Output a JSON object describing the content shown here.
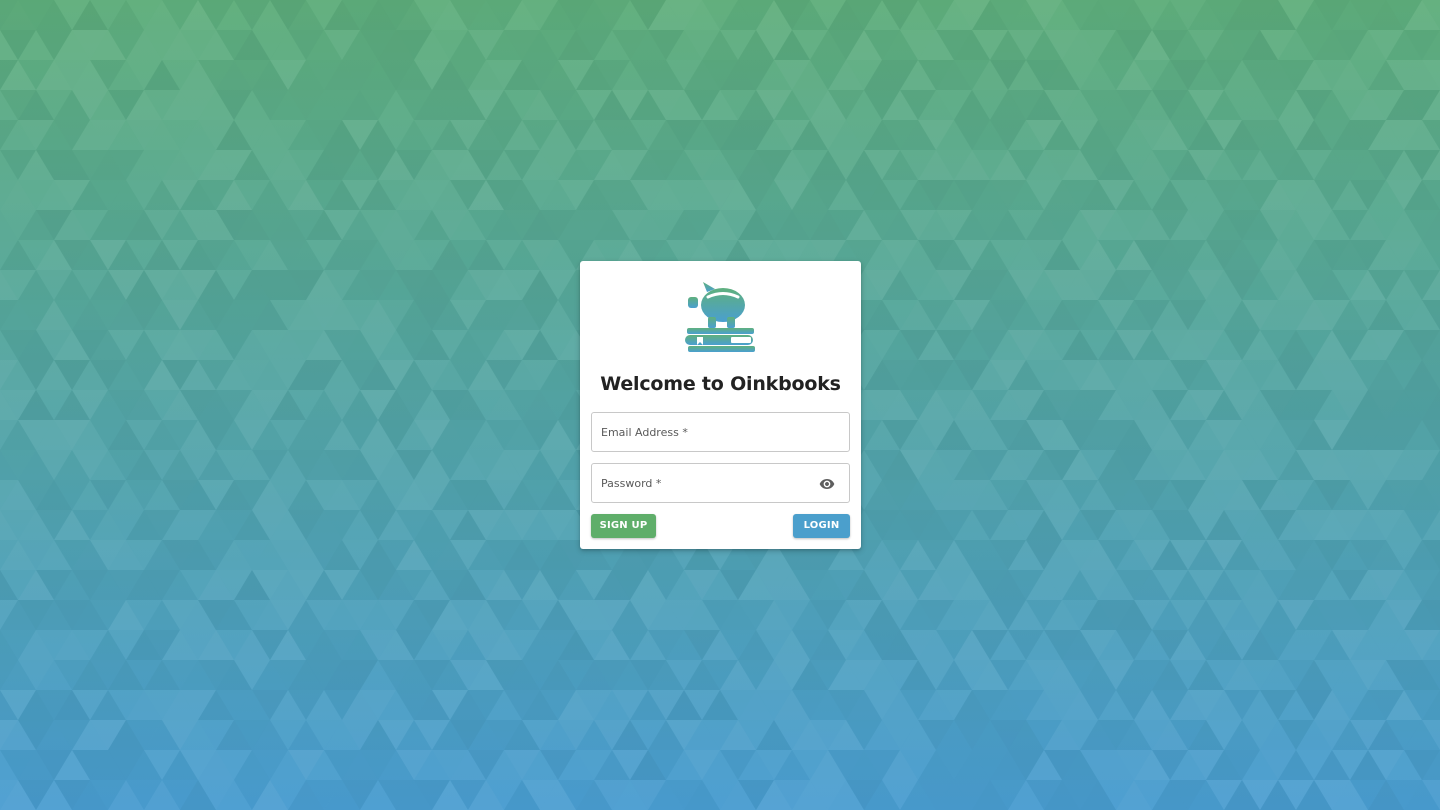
{
  "colors": {
    "background_top": "#5fae7b",
    "background_bottom": "#4a9dd1",
    "card": "#ffffff",
    "signup_button": "#5fae6a",
    "login_button": "#4b9fcc",
    "logo_top": "#5fb07e",
    "logo_bottom": "#4a9fd0"
  },
  "logo": {
    "icon": "piggy-bank-on-books-icon"
  },
  "login_form": {
    "title": "Welcome to Oinkbooks",
    "email_placeholder": "Email Address *",
    "password_placeholder": "Password *",
    "password_toggle_icon": "eye-icon",
    "signup_label": "SIGN UP",
    "login_label": "LOGIN"
  }
}
